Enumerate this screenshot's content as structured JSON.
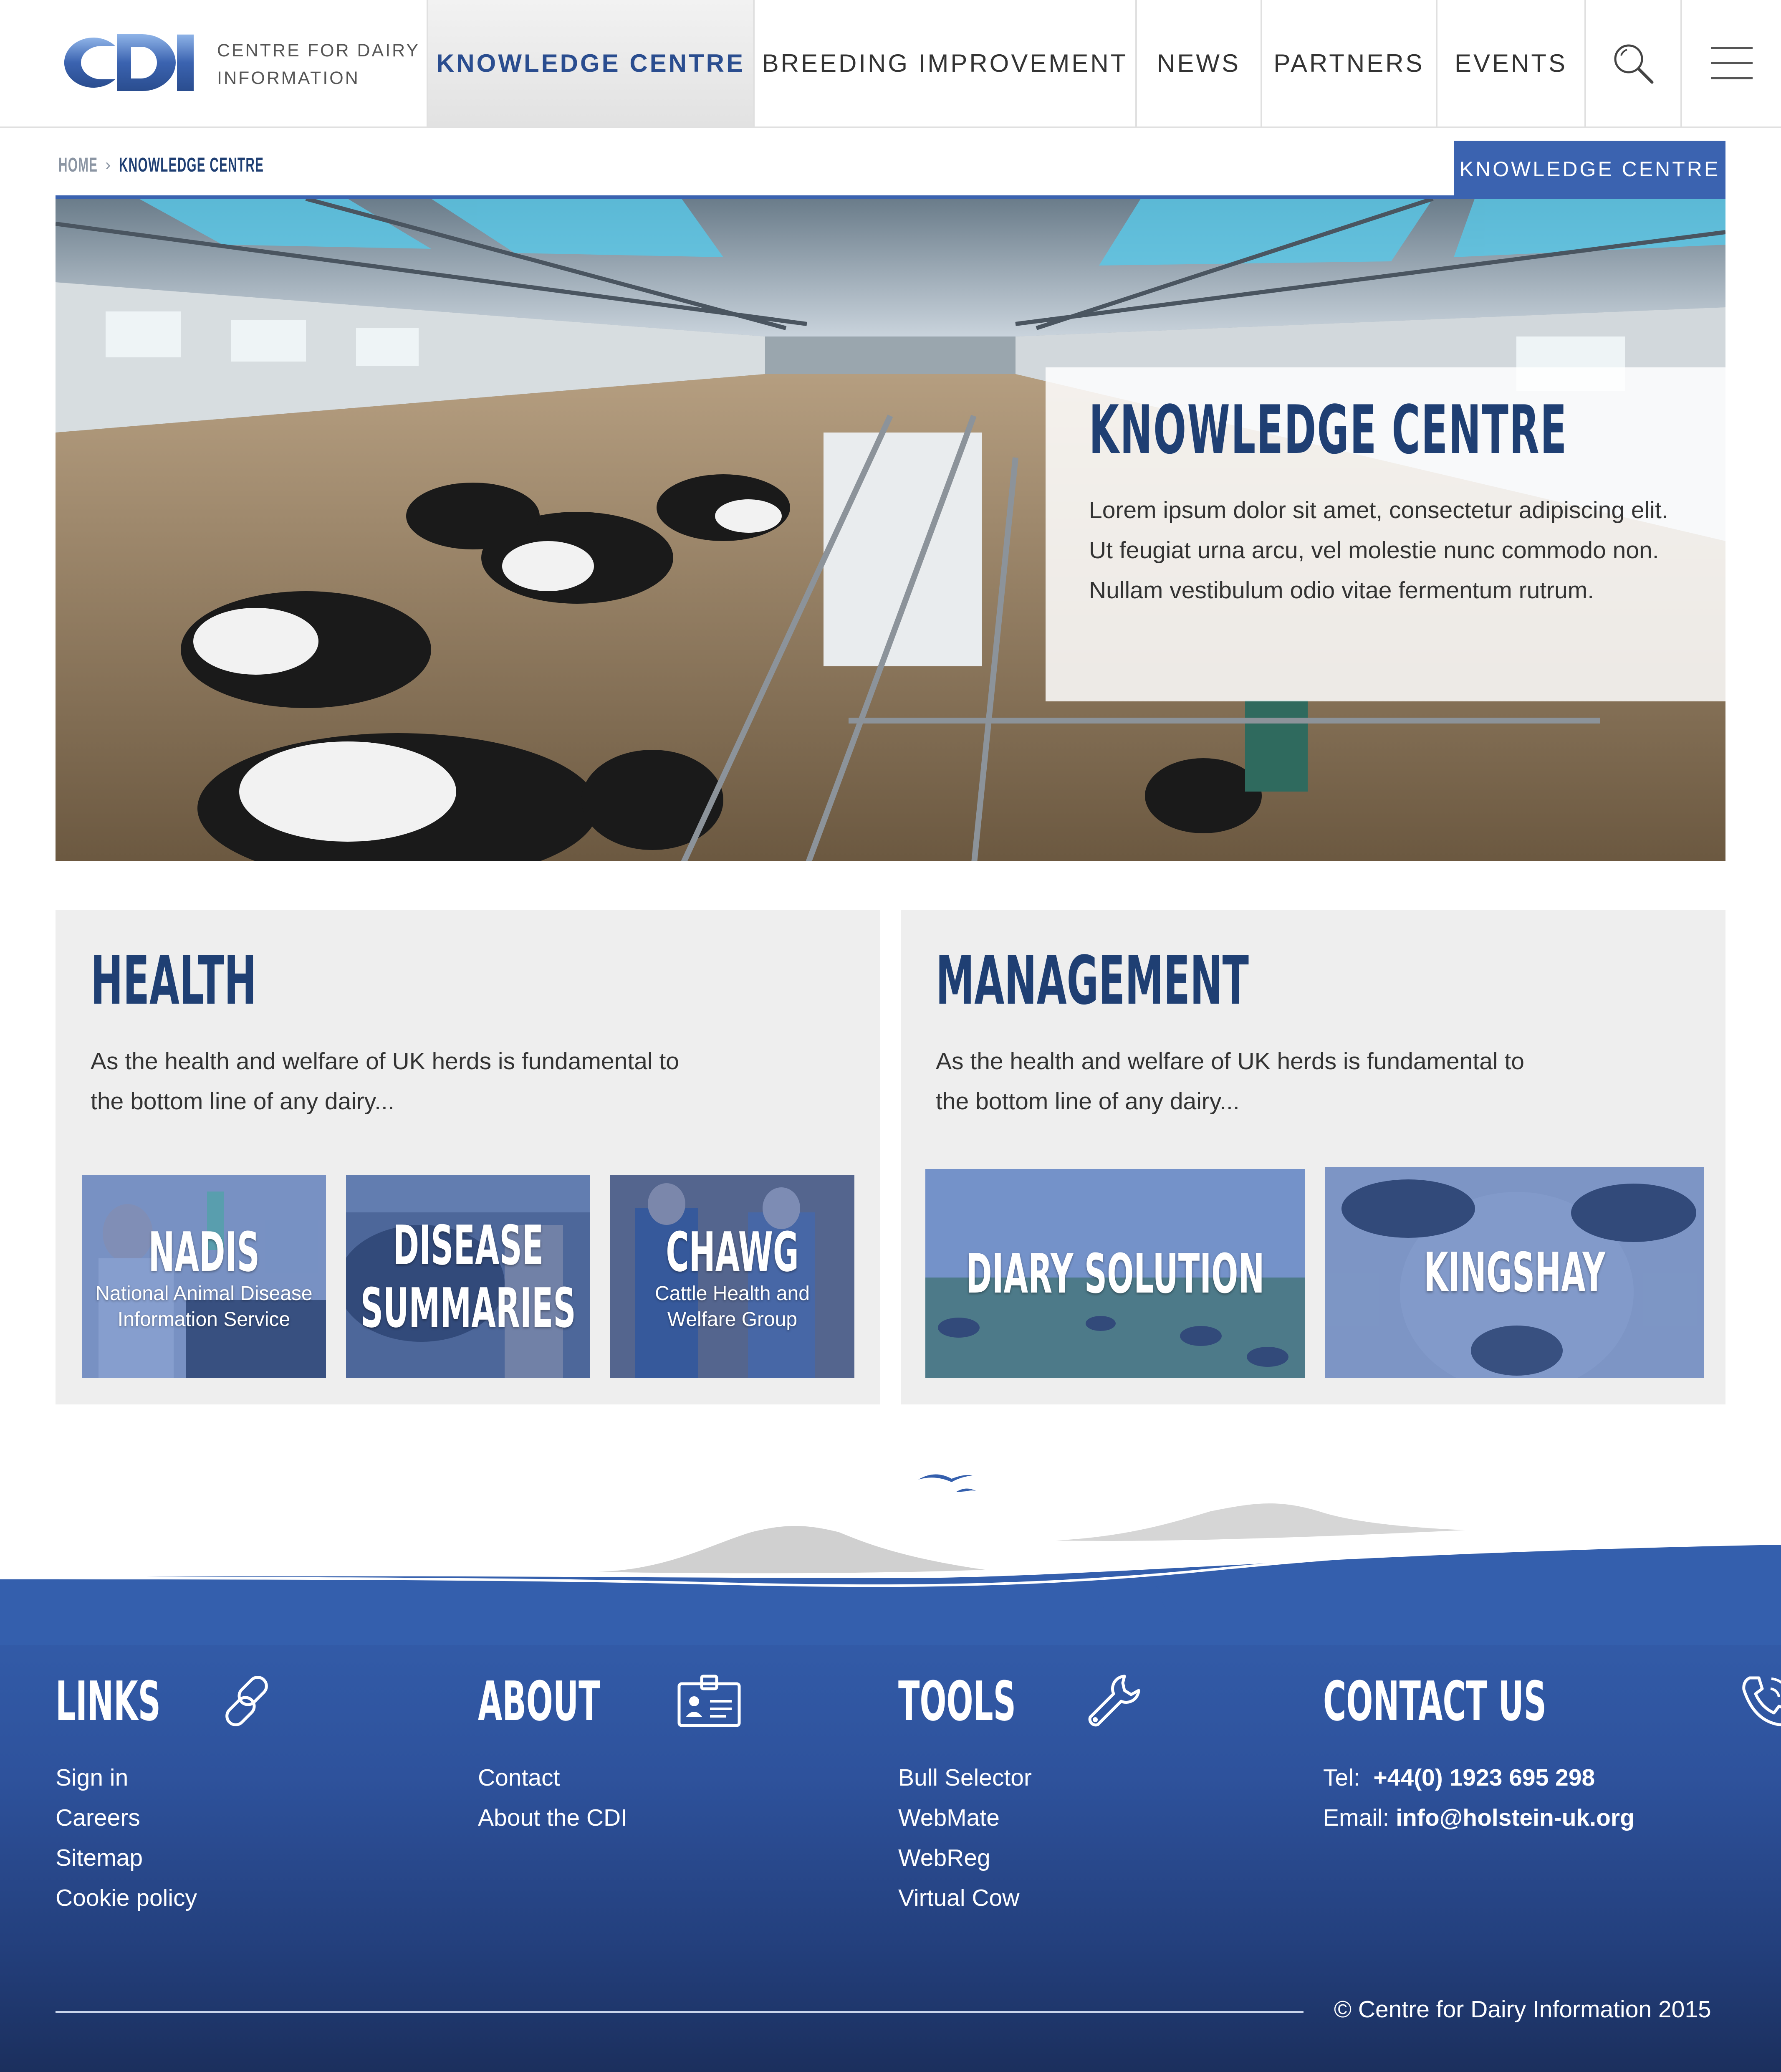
{
  "brand": {
    "logo_letters": "CDI",
    "logo_line1": "CENTRE FOR DAIRY",
    "logo_line2": "INFORMATION",
    "accent": "#3b63b0",
    "navy": "#1f3f73"
  },
  "nav": {
    "items": [
      {
        "label": "KNOWLEDGE CENTRE",
        "active": true
      },
      {
        "label": "BREEDING IMPROVEMENT"
      },
      {
        "label": "NEWS"
      },
      {
        "label": "PARTNERS"
      },
      {
        "label": "EVENTS"
      }
    ],
    "search_icon": "search-icon",
    "menu_icon": "hamburger-menu-icon"
  },
  "breadcrumb": {
    "home": "HOME",
    "separator": "›",
    "current": "KNOWLEDGE CENTRE"
  },
  "section_tag": "KNOWLEDGE CENTRE",
  "hero": {
    "title": "KNOWLEDGE CENTRE",
    "text": "Lorem ipsum dolor sit amet, consectetur adipiscing elit. Ut feugiat urna arcu, vel molestie nunc commodo non. Nullam vestibulum odio vitae fermentum rutrum."
  },
  "health": {
    "title": "HEALTH",
    "text": "As the health and welfare of UK herds is fundamental to the bottom line of any dairy...",
    "tiles": [
      {
        "title": "NADIS",
        "subtitle": "National Animal Disease Information Service"
      },
      {
        "title": "DISEASE",
        "title2": "SUMMARIES"
      },
      {
        "title": "CHAWG",
        "subtitle": "Cattle Health and Welfare Group"
      }
    ]
  },
  "management": {
    "title": "MANAGEMENT",
    "text": "As the health and welfare of UK herds is fundamental to the bottom line of any dairy...",
    "tiles": [
      {
        "title": "DIARY SOLUTION"
      },
      {
        "title": "KINGSHAY"
      }
    ]
  },
  "footer": {
    "links": {
      "title": "LINKS",
      "icon": "chain-link-icon",
      "items": [
        "Sign in",
        "Careers",
        "Sitemap",
        "Cookie policy"
      ]
    },
    "about": {
      "title": "ABOUT",
      "icon": "id-card-icon",
      "items": [
        "Contact",
        "About the CDI"
      ]
    },
    "tools": {
      "title": "TOOLS",
      "icon": "wrench-icon",
      "items": [
        "Bull Selector",
        "WebMate",
        "WebReg",
        "Virtual Cow"
      ]
    },
    "contact": {
      "title": "CONTACT US",
      "icon": "phone-icon",
      "tel_label": "Tel:",
      "tel": "+44(0) 1923 695 298",
      "email_label": "Email:",
      "email": "info@holstein-uk.org"
    },
    "copyright": "© Centre for Dairy Information 2015"
  }
}
